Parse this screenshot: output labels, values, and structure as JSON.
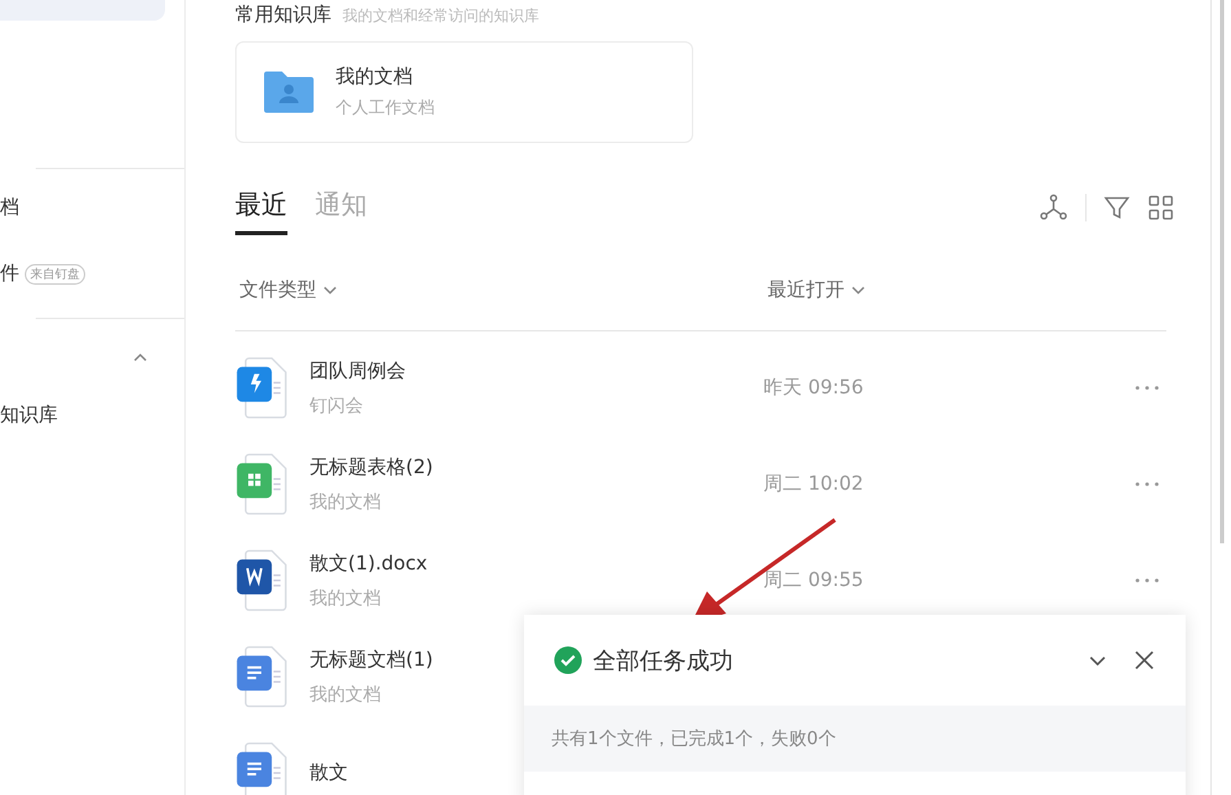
{
  "sidebar": {
    "items": [
      {
        "label": "档"
      },
      {
        "label": "件",
        "badge": "来自钉盘"
      }
    ],
    "group": {
      "label": "知识库",
      "expanded": true
    }
  },
  "knowledge": {
    "title": "常用知识库",
    "subtitle": "我的文档和经常访问的知识库",
    "card": {
      "name": "我的文档",
      "description": "个人工作文档"
    }
  },
  "tabs": [
    {
      "label": "最近",
      "selected": true
    },
    {
      "label": "通知",
      "selected": false
    }
  ],
  "columns": [
    {
      "label": "文件类型"
    },
    {
      "label": "最近打开"
    }
  ],
  "rows": [
    {
      "kind": "flash",
      "title": "团队周例会",
      "location": "钉闪会",
      "time": "昨天 09:56"
    },
    {
      "kind": "sheet",
      "title": "无标题表格(2)",
      "location": "我的文档",
      "time": "周二 10:02"
    },
    {
      "kind": "word",
      "title": "散文(1).docx",
      "location": "我的文档",
      "time": "周二 09:55"
    },
    {
      "kind": "doc",
      "title": "无标题文档(1)",
      "location": "我的文档"
    },
    {
      "kind": "doc",
      "title": "散文"
    }
  ],
  "task_popup": {
    "succeeded": true,
    "title": "全部任务成功",
    "summary": "共有1个文件，已完成1个，失败0个"
  }
}
